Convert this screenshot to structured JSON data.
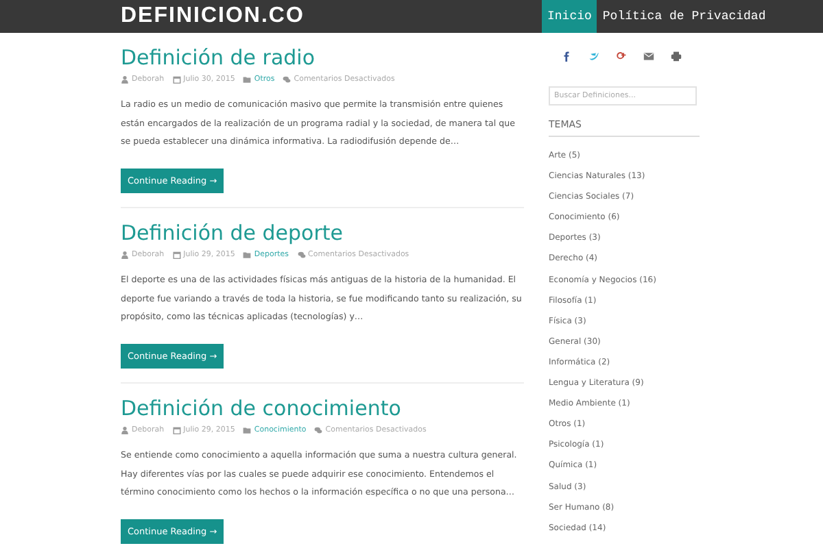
{
  "header": {
    "logo": "DEFINICION.CO",
    "nav": [
      {
        "label": "Inicio",
        "selected": true
      },
      {
        "label": "Política de Privacidad",
        "selected": false
      }
    ]
  },
  "posts": [
    {
      "title": "Definición de radio",
      "author": "Deborah",
      "date": "Julio 30, 2015",
      "category": "Otros",
      "comments": "Comentarios Desactivados",
      "excerpt": "La radio es un medio de comunicación masivo que permite la transmisión entre quienes están encargados de la realización de un programa radial y la sociedad, de manera tal que se pueda establecer una dinámica informativa. La radiodifusión depende de…",
      "button": "Continue Reading →"
    },
    {
      "title": "Definición de deporte",
      "author": "Deborah",
      "date": "Julio 29, 2015",
      "category": "Deportes",
      "comments": "Comentarios Desactivados",
      "excerpt": "El deporte es una de las actividades físicas más antiguas de la historia de la humanidad. El deporte fue variando a través de toda la historia, se fue modificando tanto su realización, su propósito, como las técnicas aplicadas (tecnologías) y…",
      "button": "Continue Reading →"
    },
    {
      "title": "Definición de conocimiento",
      "author": "Deborah",
      "date": "Julio 29, 2015",
      "category": "Conocimiento",
      "comments": "Comentarios Desactivados",
      "excerpt": "Se entiende como conocimiento a aquella información que suma a nuestra cultura general. Hay diferentes vías por las cuales se puede adquirir ese conocimiento. Entendemos el término conocimiento como los hechos o la información específica o no que una persona…",
      "button": "Continue Reading →"
    }
  ],
  "sidebar": {
    "share": [
      {
        "kind": "facebook"
      },
      {
        "kind": "twitter"
      },
      {
        "kind": "googleplus"
      },
      {
        "kind": "email"
      },
      {
        "kind": "print"
      }
    ],
    "search": {
      "placeholder": "Buscar Definiciones..."
    },
    "topics_title": "TEMAS",
    "topics": [
      "Arte (5)",
      "Ciencias Naturales (13)",
      "Ciencias Sociales (7)",
      "Conocimiento (6)",
      "Deportes (3)",
      "Derecho (4)",
      "Economía y Negocios (16)",
      "Filosofía (1)",
      "Física (3)",
      "General (30)",
      "Informática (2)",
      "Lengua y Literatura (9)",
      "Medio Ambiente (1)",
      "Otros (1)",
      "Psicología (1)",
      "Química (1)",
      "Salud (3)",
      "Ser Humano (8)",
      "Sociedad (14)"
    ]
  }
}
